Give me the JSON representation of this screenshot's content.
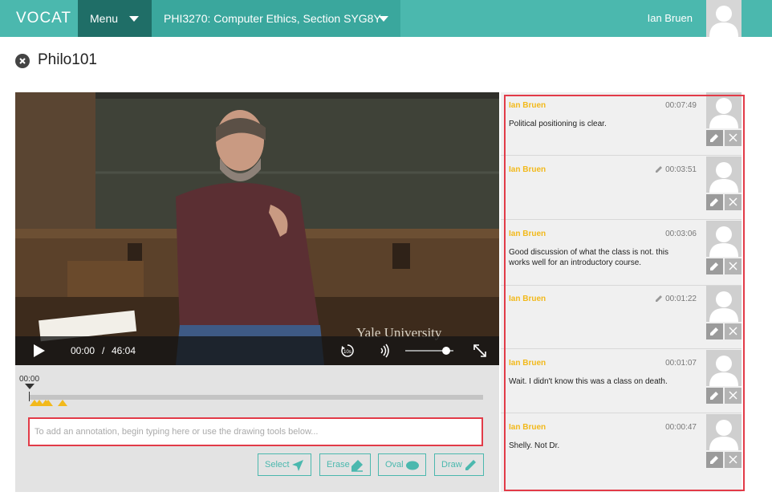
{
  "app": {
    "logo": "VOCAT"
  },
  "header": {
    "menu_label": "Menu",
    "course_label": "PHI3270: Computer Ethics, Section SYG8Y",
    "user_name": "Ian Bruen"
  },
  "page": {
    "title": "Philo101"
  },
  "video": {
    "watermark": "Yale University",
    "current_time": "00:00",
    "separator": "/",
    "duration": "46:04",
    "skip_label": "10s",
    "volume": 0.85,
    "progress": 0.0
  },
  "timeline": {
    "marker_time": "00:00",
    "annotation_markers": [
      0.6,
      1.07,
      1.72,
      1.95,
      3.41
    ]
  },
  "annotation": {
    "placeholder": "To add an annotation, begin typing here or use the drawing tools below..."
  },
  "tools": [
    {
      "label": "Select",
      "icon": "select-arrow-icon"
    },
    {
      "label": "Erase",
      "icon": "eraser-icon"
    },
    {
      "label": "Oval",
      "icon": "oval-icon"
    },
    {
      "label": "Draw",
      "icon": "pencil-icon"
    }
  ],
  "comments": [
    {
      "author": "Ian Bruen",
      "time": "00:07:49",
      "text": "Political positioning is clear.",
      "edited": false
    },
    {
      "author": "Ian Bruen",
      "time": "00:03:51",
      "text": "",
      "edited": true
    },
    {
      "author": "Ian Bruen",
      "time": "00:03:06",
      "text": "Good discussion of what the class is not. this works well for an introductory course.",
      "edited": false
    },
    {
      "author": "Ian Bruen",
      "time": "00:01:22",
      "text": "",
      "edited": true
    },
    {
      "author": "Ian Bruen",
      "time": "00:01:07",
      "text": "Wait. I didn't know this was a class on death.",
      "edited": false
    },
    {
      "author": "Ian Bruen",
      "time": "00:00:47",
      "text": "Shelly. Not Dr.",
      "edited": false
    }
  ],
  "colors": {
    "brand": "#4bb8ae",
    "menu_dark": "#1f6e67",
    "author": "#f2b91b",
    "highlight_border": "#e23b48"
  }
}
